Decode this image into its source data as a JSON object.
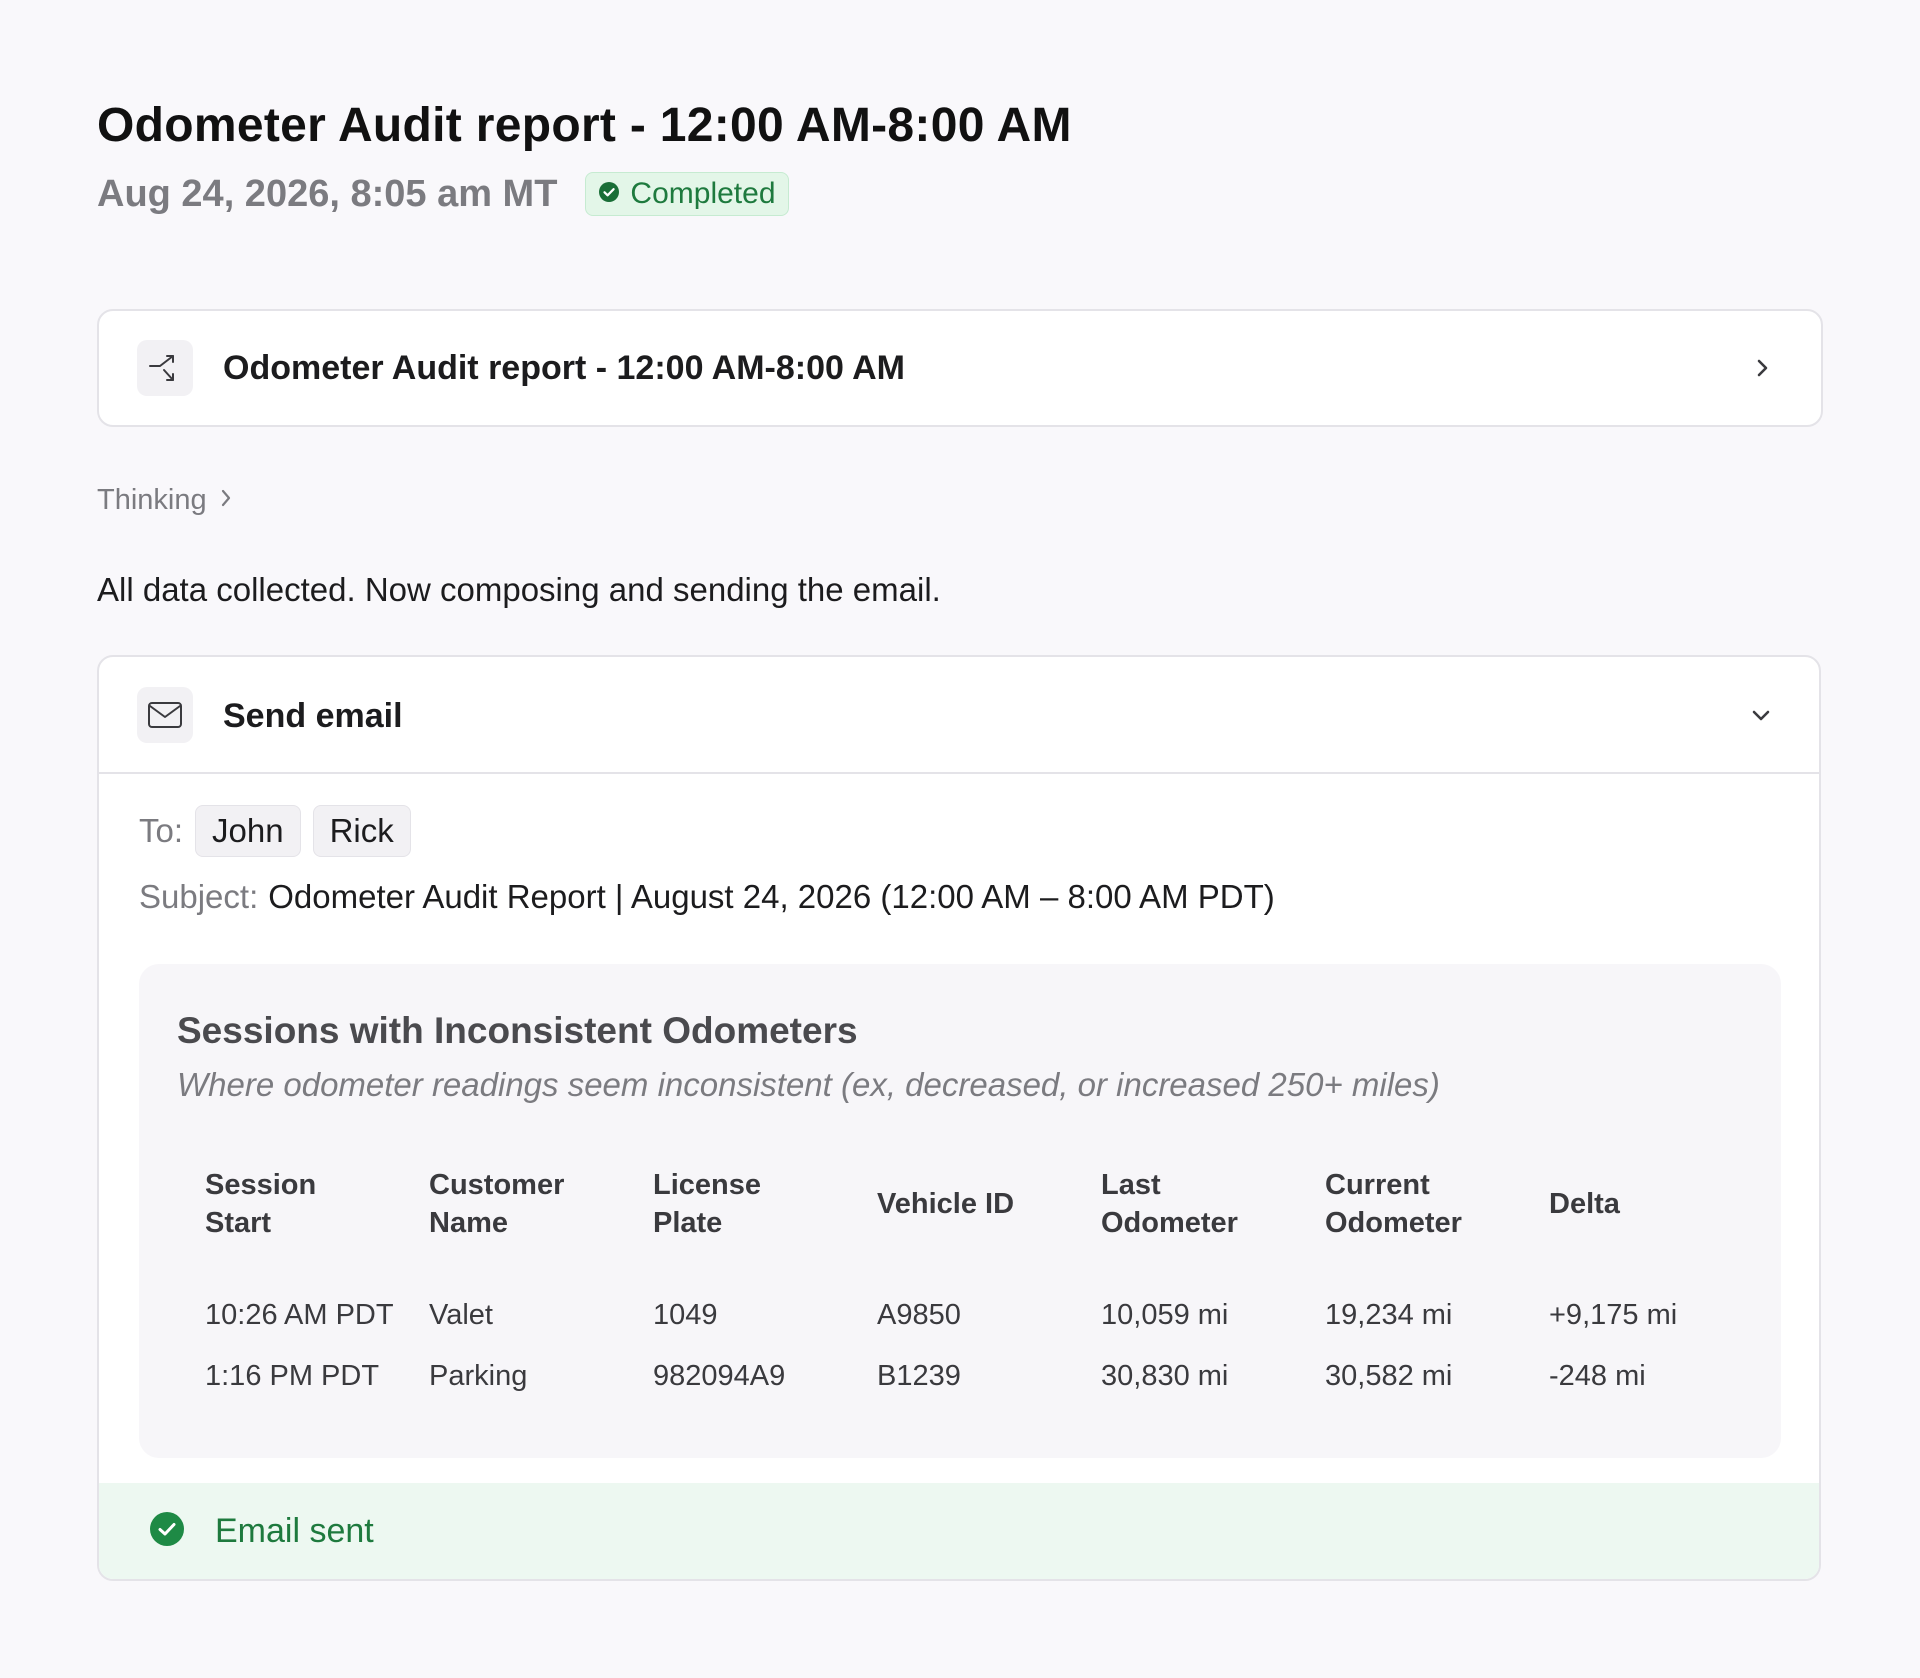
{
  "page": {
    "title": "Odometer Audit report - 12:00 AM-8:00 AM",
    "date": "Aug 24, 2026, 8:05 am MT",
    "status": "Completed"
  },
  "report_card": {
    "title": "Odometer Audit report - 12:00 AM-8:00 AM",
    "icon": "workflow-icon"
  },
  "thinking": {
    "label": "Thinking"
  },
  "status_message": "All data collected. Now composing and sending the email.",
  "email": {
    "title": "Send email",
    "icon": "mail-icon",
    "to_label": "To:",
    "recipients": [
      "John",
      "Rick"
    ],
    "subject_label": "Subject:",
    "subject": "Odometer Audit Report | August 24, 2026 (12:00 AM – 8:00 AM PDT)",
    "body": {
      "heading": "Sessions with Inconsistent Odometers",
      "subheading": "Where odometer readings seem inconsistent (ex, decreased, or increased 250+ miles)",
      "table": {
        "headers": [
          [
            "Session",
            "Start"
          ],
          [
            "Customer",
            "Name"
          ],
          [
            "License",
            "Plate"
          ],
          [
            "Vehicle ID"
          ],
          [
            "Last",
            "Odometer"
          ],
          [
            "Current",
            "Odometer"
          ],
          [
            "Delta"
          ]
        ],
        "rows": [
          [
            "10:26 AM PDT",
            "Valet",
            "1049",
            "A9850",
            "10,059 mi",
            "19,234 mi",
            "+9,175 mi"
          ],
          [
            "1:16 PM PDT",
            "Parking",
            "982094A9",
            "B1239",
            "30,830 mi",
            "30,582 mi",
            "-248 mi"
          ]
        ]
      }
    },
    "sent_status": "Email sent"
  },
  "colors": {
    "success": "#1e7a3e",
    "success_bg": "#edf8f1",
    "badge_bg": "#e3f6e8",
    "muted_text": "#7b7b80",
    "card_border": "#e4e3e8"
  }
}
